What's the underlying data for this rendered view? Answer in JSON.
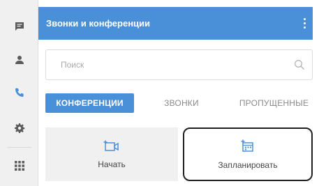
{
  "rail": {
    "items": [
      {
        "icon": "chat-icon"
      },
      {
        "icon": "contact-icon"
      },
      {
        "icon": "phone-icon"
      },
      {
        "icon": "gear-icon"
      },
      {
        "icon": "grid-icon"
      }
    ]
  },
  "header": {
    "title": "Звонки и конференции",
    "menu_icon": "more-vertical-icon"
  },
  "search": {
    "placeholder": "Поиск",
    "icon": "search-icon"
  },
  "tabs": [
    {
      "label": "КОНФЕРЕНЦИИ",
      "active": true
    },
    {
      "label": "ЗВОНКИ",
      "active": false
    },
    {
      "label": "ПРОПУЩЕННЫЕ",
      "active": false
    }
  ],
  "actions": {
    "start": {
      "label": "Начать",
      "icon": "video-add-icon"
    },
    "schedule": {
      "label": "Запланировать",
      "icon": "calendar-add-icon"
    }
  },
  "colors": {
    "accent": "#4a90d9",
    "rail_bg": "#f0f0f0"
  }
}
